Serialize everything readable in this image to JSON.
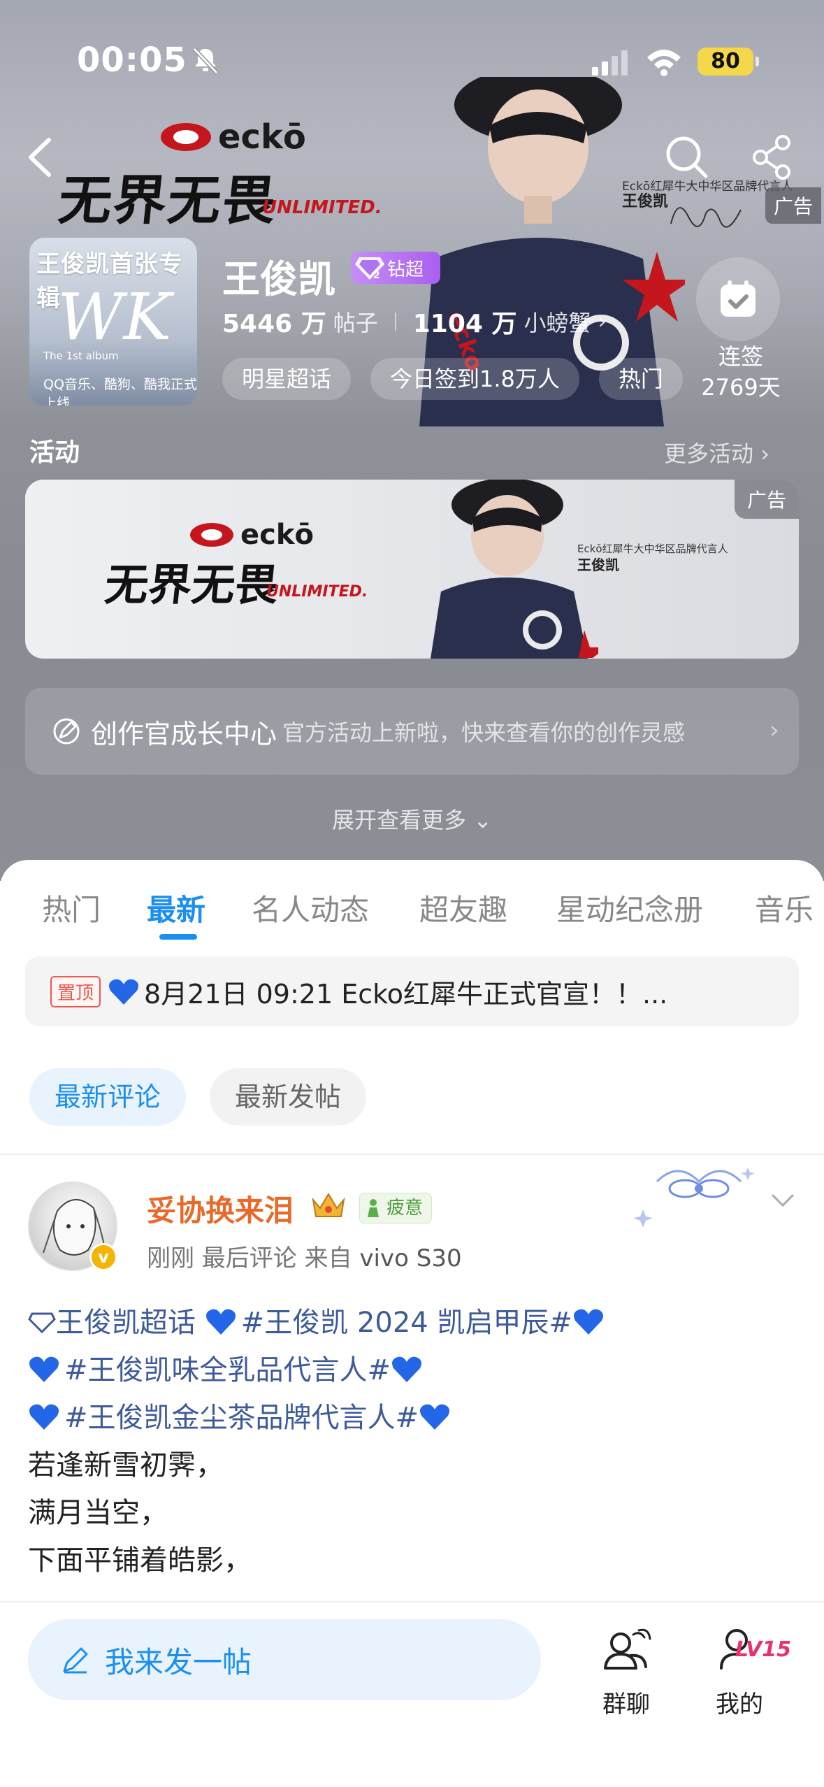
{
  "status_bar": {
    "time": "00:05",
    "battery": "80"
  },
  "header": {
    "ad_label": "广告",
    "brand": {
      "logo_word": "eckō",
      "slogan": "无界无畏",
      "slogan_sub": "UNLIMITED.",
      "endorse_line": "Eckō红犀牛大中华区品牌代言人",
      "endorse_name": "王俊凯"
    }
  },
  "album": {
    "title": "王俊凯首张专辑",
    "monogram": "WK",
    "subtitle": "The 1st album",
    "caption": "QQ音乐、酷狗、酷我正式上线"
  },
  "profile": {
    "name": "王俊凯",
    "badge": "钻超",
    "badge_level": "2",
    "posts_count": "5446 万",
    "posts_label": "帖子",
    "fans_count": "1104 万",
    "fans_label": "小螃蟹",
    "chips": [
      "明星超话",
      "今日签到1.8万人",
      "热门"
    ],
    "checkin_label": "连签",
    "checkin_days": "2769天"
  },
  "activity": {
    "title": "活动",
    "more": "更多活动",
    "banner_ad_label": "广告",
    "creator_title": "创作官成长中心",
    "creator_desc": "官方活动上新啦，快来查看你的创作灵感",
    "expand": "展开查看更多"
  },
  "tabs": [
    {
      "label": "热门",
      "active": false
    },
    {
      "label": "最新",
      "active": true
    },
    {
      "label": "名人动态",
      "active": false
    },
    {
      "label": "超友趣",
      "active": false
    },
    {
      "label": "星动纪念册",
      "active": false
    },
    {
      "label": "音乐",
      "active": false
    }
  ],
  "pinned": {
    "tag": "置顶",
    "text": "8月21日 09:21 Ecko红犀牛正式官宣！！..."
  },
  "filters": {
    "active": "最新评论",
    "inactive": "最新发帖"
  },
  "post": {
    "user_name": "妥协换来泪",
    "mood": "疲意",
    "time": "刚刚",
    "action": "最后评论",
    "from_label": "来自",
    "device": "vivo S30",
    "lines": [
      {
        "parts": [
          {
            "type": "diamond"
          },
          {
            "type": "text",
            "cls": "blue",
            "text": "王俊凯超话 "
          },
          {
            "type": "heart"
          },
          {
            "type": "text",
            "cls": "blue",
            "text": "#王俊凯 2024 凯启甲辰#"
          },
          {
            "type": "heart"
          }
        ]
      },
      {
        "parts": [
          {
            "type": "heart"
          },
          {
            "type": "text",
            "cls": "blue",
            "text": "#王俊凯味全乳品代言人#"
          },
          {
            "type": "heart"
          }
        ]
      },
      {
        "parts": [
          {
            "type": "heart"
          },
          {
            "type": "text",
            "cls": "blue",
            "text": "#王俊凯金尘茶品牌代言人#"
          },
          {
            "type": "heart"
          }
        ]
      },
      {
        "parts": [
          {
            "type": "text",
            "cls": "",
            "text": "若逢新雪初霁，"
          }
        ]
      },
      {
        "parts": [
          {
            "type": "text",
            "cls": "",
            "text": "满月当空，"
          }
        ]
      },
      {
        "parts": [
          {
            "type": "text",
            "cls": "",
            "text": "下面平铺着皓影，"
          }
        ]
      }
    ]
  },
  "bottom_bar": {
    "compose_label": "我来发一帖",
    "group_chat": "群聊",
    "mine": "我的",
    "level": "LV15"
  },
  "colors": {
    "accent": "#1b8ff0",
    "username": "#e86a2a",
    "badge": "#a95ff0",
    "hashtag": "#3d5a99"
  }
}
